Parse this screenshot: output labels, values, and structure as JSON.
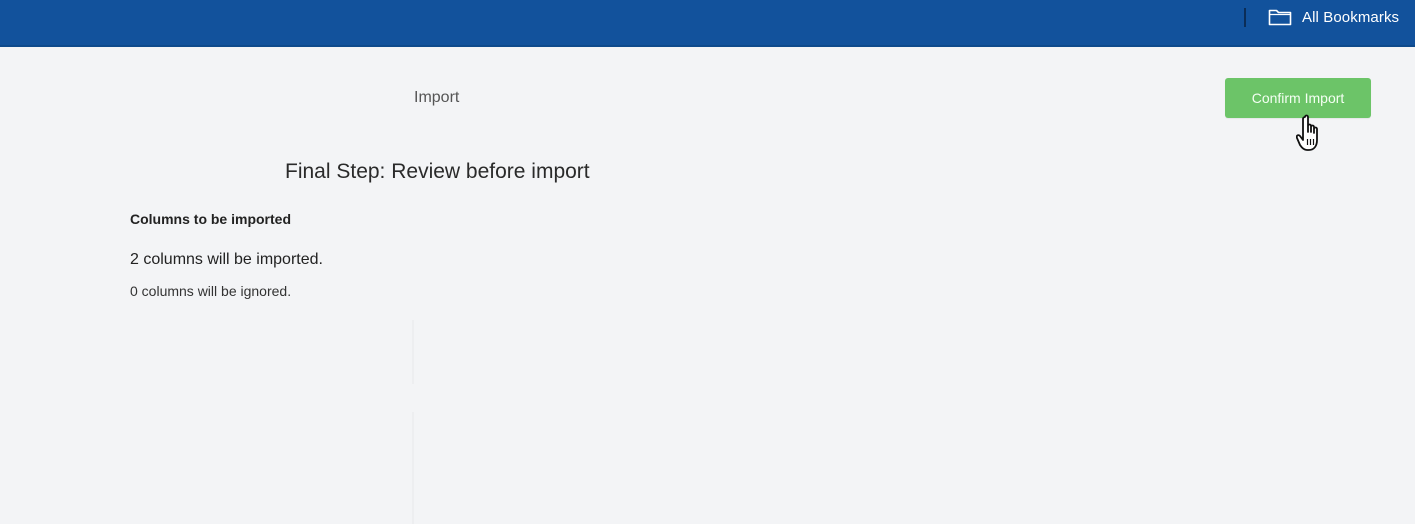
{
  "header": {
    "bookmarks_label": "All Bookmarks",
    "bookmarks_icon": "folder-icon",
    "background_color": "#12529c"
  },
  "main": {
    "breadcrumb": "Import",
    "confirm_button_label": "Confirm Import",
    "confirm_button_color": "#6cc468",
    "title": "Final Step: Review before import",
    "section_heading": "Columns to be imported",
    "imported_text": "2 columns will be imported.",
    "ignored_text": "0 columns will be ignored."
  },
  "cursor": {
    "icon": "hand-pointer-icon"
  }
}
